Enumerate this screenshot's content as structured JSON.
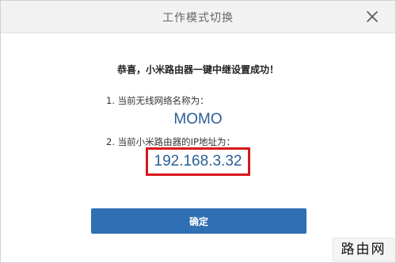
{
  "dialog": {
    "title": "工作模式切换",
    "close_icon": "close-icon"
  },
  "content": {
    "success_message": "恭喜，小米路由器一键中继设置成功！",
    "wifi_label": "1. 当前无线网络名称为：",
    "wifi_name": "MOMO",
    "ip_label": "2. 当前小米路由器的IP地址为：",
    "ip_address": "192.168.3.32",
    "highlight_color": "#d8171d",
    "value_color": "#2b5f96"
  },
  "actions": {
    "confirm_label": "确定",
    "confirm_color": "#2f6fb3"
  },
  "watermark": {
    "text": "路由网"
  }
}
